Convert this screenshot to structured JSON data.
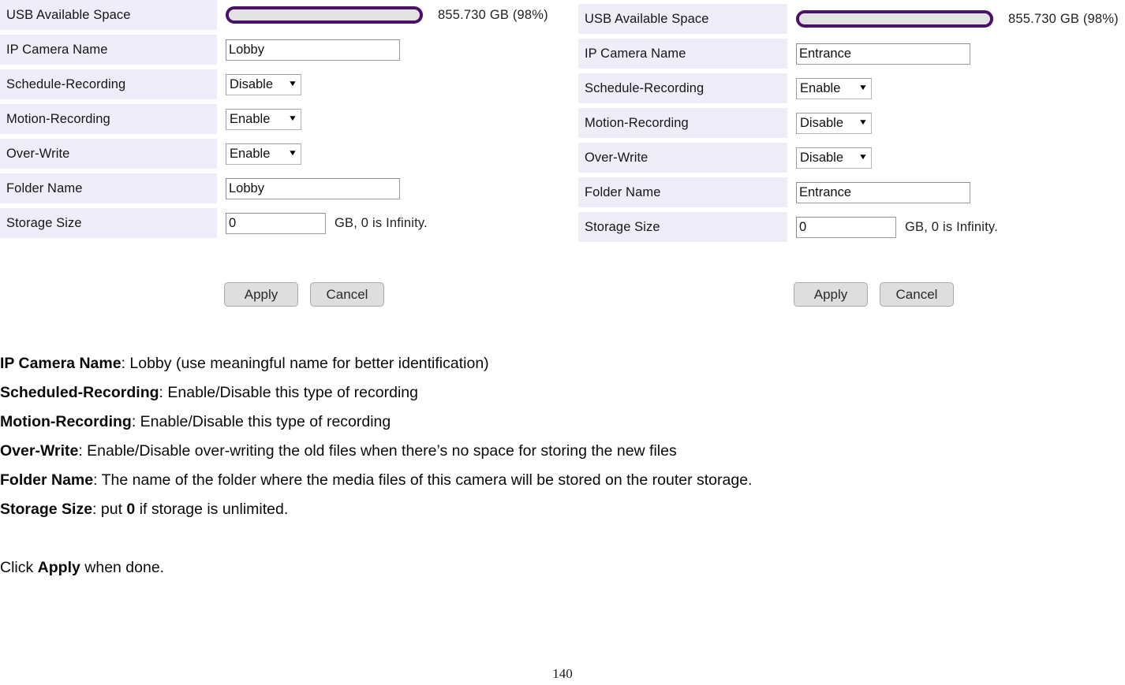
{
  "panels": [
    {
      "id": "left",
      "rows": [
        {
          "label": "USB Available Space",
          "type": "progress",
          "value_text": "855.730 GB (98%)",
          "percent": 98
        },
        {
          "label": "IP Camera Name",
          "type": "text",
          "value": "Lobby"
        },
        {
          "label": "Schedule-Recording",
          "type": "select",
          "value": "Disable",
          "options": [
            "Enable",
            "Disable"
          ]
        },
        {
          "label": "Motion-Recording",
          "type": "select",
          "value": "Enable",
          "options": [
            "Enable",
            "Disable"
          ]
        },
        {
          "label": "Over-Write",
          "type": "select",
          "value": "Enable",
          "options": [
            "Enable",
            "Disable"
          ]
        },
        {
          "label": "Folder Name",
          "type": "text",
          "value": "Lobby"
        },
        {
          "label": "Storage Size",
          "type": "number",
          "value": "0",
          "hint": "GB, 0 is Infinity."
        }
      ],
      "apply_label": "Apply",
      "cancel_label": "Cancel"
    },
    {
      "id": "right",
      "rows": [
        {
          "label": "USB Available Space",
          "type": "progress",
          "value_text": "855.730 GB (98%)",
          "percent": 98
        },
        {
          "label": "IP Camera Name",
          "type": "text",
          "value": "Entrance"
        },
        {
          "label": "Schedule-Recording",
          "type": "select",
          "value": "Enable",
          "options": [
            "Enable",
            "Disable"
          ]
        },
        {
          "label": "Motion-Recording",
          "type": "select",
          "value": "Disable",
          "options": [
            "Enable",
            "Disable"
          ]
        },
        {
          "label": "Over-Write",
          "type": "select",
          "value": "Disable",
          "options": [
            "Enable",
            "Disable"
          ]
        },
        {
          "label": "Folder Name",
          "type": "text",
          "value": "Entrance"
        },
        {
          "label": "Storage Size",
          "type": "number",
          "value": "0",
          "hint": "GB, 0 is Infinity."
        }
      ],
      "apply_label": "Apply",
      "cancel_label": "Cancel"
    }
  ],
  "prose": [
    {
      "term": "IP Camera Name",
      "rest": ": Lobby (use meaningful name for better identification)"
    },
    {
      "term": "Scheduled-Recording",
      "rest": ": Enable/Disable this type of recording"
    },
    {
      "term": "Motion-Recording",
      "rest": ": Enable/Disable this type of recording"
    },
    {
      "term": "Over-Write",
      "rest": ": Enable/Disable over-writing the old files when there’s no space for storing the new files"
    },
    {
      "term": "Folder Name",
      "rest": ": The name of the folder where the media files of this camera will be stored on the router storage."
    },
    {
      "term": "Storage Size",
      "rest": ": put ",
      "bold_mid": "0",
      "tail": " if storage is unlimited."
    }
  ],
  "closing": {
    "pre": "Click ",
    "bold": "Apply",
    "post": " when done."
  },
  "footer": {
    "page_number": "140"
  },
  "icons": {
    "caret_down": "▼"
  },
  "colors": {
    "row_label_bg": "#f0edfa",
    "progress_border": "#4b1068",
    "progress_track": "#e3e3e3",
    "button_bg": "#dedede"
  }
}
